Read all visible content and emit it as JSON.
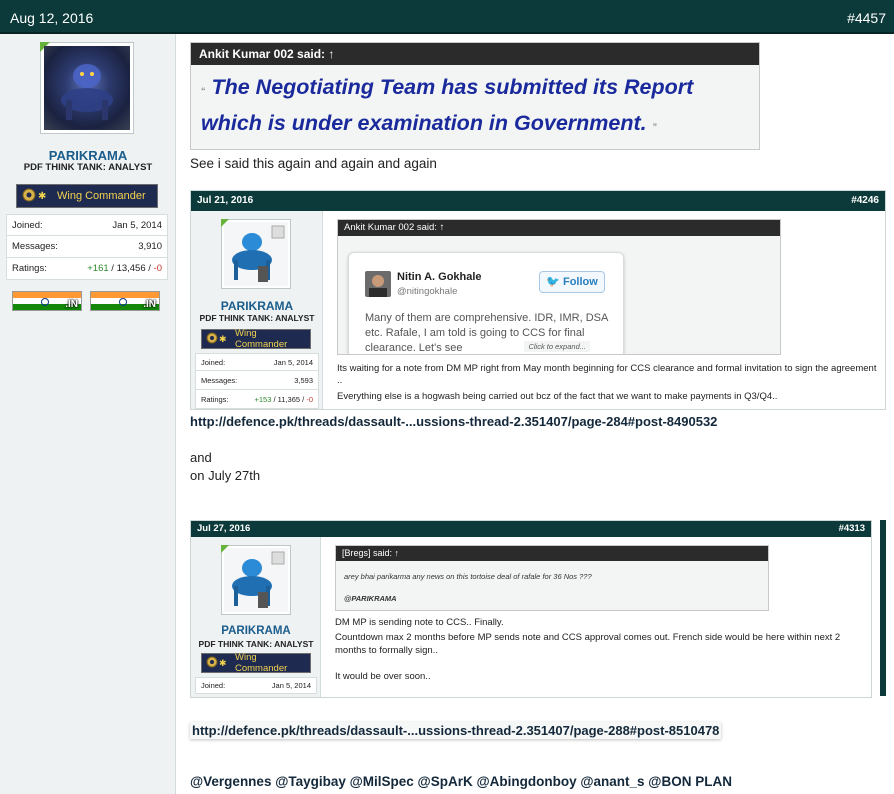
{
  "post": {
    "date": "Aug 12, 2016",
    "number": "#4457"
  },
  "user": {
    "name": "PARIKRAMA",
    "title": "PDF THINK TANK: ANALYST",
    "rank": "Wing Commander",
    "joined_label": "Joined:",
    "joined_value": "Jan 5, 2014",
    "messages_label": "Messages:",
    "messages_value": "3,910",
    "ratings_label": "Ratings:",
    "ratings_pos": "+161",
    "ratings_sep": "/",
    "ratings_mid": "13,456",
    "ratings_neg": "-0",
    "flag_text": ".IN"
  },
  "main_quote": {
    "author": "Ankit Kumar 002 said:",
    "arrow": "↑",
    "open_mark": "“",
    "text": "The Negotiating Team has submitted its Report which is under examination in Government.",
    "close_mark": "”"
  },
  "body_line": "See i said this again and again and again",
  "embed1": {
    "date": "Jul 21, 2016",
    "number": "#4246",
    "user_name": "PARIKRAMA",
    "user_title": "PDF THINK TANK: ANALYST",
    "rank": "Wing Commander",
    "joined_label": "Joined:",
    "joined_value": "Jan 5, 2014",
    "messages_label": "Messages:",
    "messages_value": "3,593",
    "ratings_label": "Ratings:",
    "ratings_pos": "+153",
    "ratings_mid": "11,365",
    "ratings_neg": "-0",
    "quote_author": "Ankit Kumar 002 said:",
    "arrow": "↑",
    "tweet_name": "Nitin A. Gokhale",
    "tweet_handle": "@nitingokhale",
    "follow": "Follow",
    "tweet_text": "Many of them are comprehensive. IDR, IMR, DSA etc. Rafale, I am told is going to CCS for final clearance. Let's see",
    "click_expand": "Click to expand...",
    "reply_1": "Its waiting for a note from DM MP right from May month beginning for CCS clearance and formal invitation to sign the agreement ..",
    "reply_2": "Everything else is a hogwash being carried out bcz of the fact that we want to make payments in Q3/Q4.."
  },
  "link1": "http://defence.pk/threads/dassault-...ussions-thread-2.351407/page-284#post-8490532",
  "and_text": "and",
  "july_text": "on July 27th",
  "embed2": {
    "date": "Jul 27, 2016",
    "number": "#4313",
    "user_name": "PARIKRAMA",
    "user_title": "PDF THINK TANK: ANALYST",
    "rank": "Wing Commander",
    "joined_label": "Joined:",
    "joined_value": "Jan 5, 2014",
    "quote_author": "[Bregs] said:",
    "arrow": "↑",
    "quote_text": "arey bhai parikarma any news on this tortoise deal of rafale for 36 Nos ???",
    "quote_mention": "@PARIKRAMA",
    "reply_1": "DM MP is sending note to CCS.. Finally.",
    "reply_2": "Countdown max 2 months before MP sends note and CCS approval comes out. French side would be here within next 2 months to formally sign..",
    "reply_3": "It would be over soon.."
  },
  "link2": "http://defence.pk/threads/dassault-...ussions-thread-2.351407/page-288#post-8510478",
  "mentions": "@Vergennes @Taygibay @MilSpec @SpArK @Abingdonboy @anant_s @BON PLAN",
  "colors": {
    "header_bg": "#0c3a3a",
    "username": "#1a5d8c",
    "quote_text": "#1a2a9c",
    "rank_text": "#f2d34f",
    "positive": "#2c8a2c",
    "negative": "#c0392b"
  }
}
